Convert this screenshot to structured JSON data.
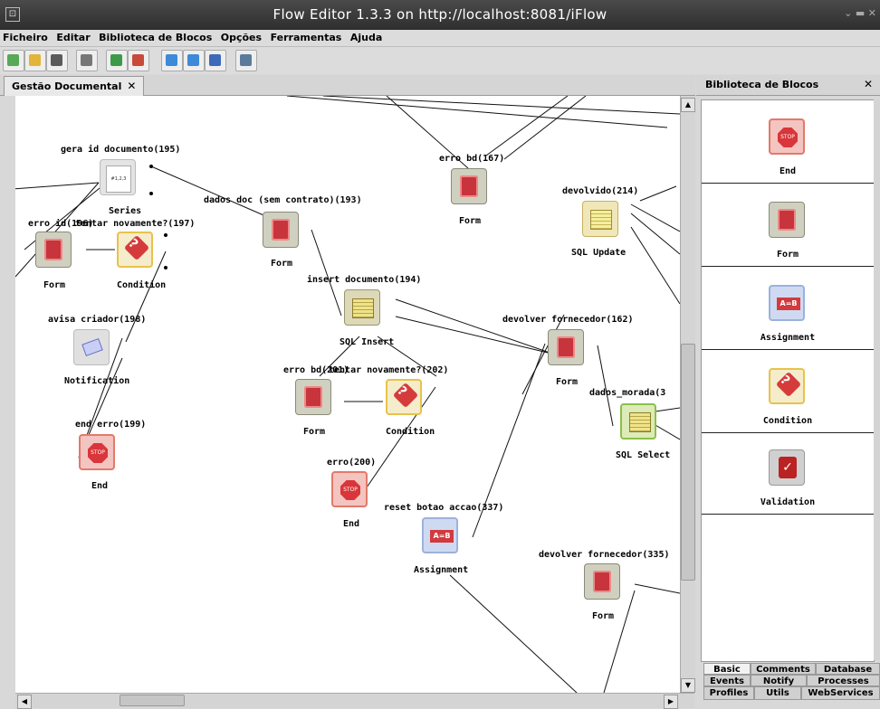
{
  "window": {
    "title": "Flow Editor 1.3.3 on http://localhost:8081/iFlow"
  },
  "menu": [
    "Ficheiro",
    "Editar",
    "Biblioteca de Blocos",
    "Opções",
    "Ferramentas",
    "Ajuda"
  ],
  "toolbar": [
    {
      "icon": "new-document-icon",
      "color": "#57a857"
    },
    {
      "icon": "open-folder-icon",
      "color": "#e2b43a"
    },
    {
      "icon": "save-icon",
      "color": "#5a5a5a"
    },
    {
      "icon": "print-icon",
      "color": "#777777"
    },
    {
      "icon": "export-icon",
      "color": "#3c9a4a"
    },
    {
      "icon": "import-icon",
      "color": "#c84a3a"
    },
    {
      "icon": "zoom-in-icon",
      "color": "#3c8ad8"
    },
    {
      "icon": "zoom-icon",
      "color": "#3c8ad8"
    },
    {
      "icon": "fit-icon",
      "color": "#3c6ab8"
    },
    {
      "icon": "view-icon",
      "color": "#5c7a9c"
    }
  ],
  "editor_tab": {
    "label": "Gestão Documental",
    "close": "✕"
  },
  "nodes": [
    {
      "id": "n1",
      "title": "gera id documento(195)",
      "type": "Series",
      "icon": "series"
    },
    {
      "id": "n2",
      "title": "erro id(196)",
      "type": "Form",
      "icon": "form"
    },
    {
      "id": "n3",
      "title": "tentar novamente?(197)",
      "type": "Condition",
      "icon": "cond"
    },
    {
      "id": "n4",
      "title": "avisa criador(198)",
      "type": "Notification",
      "icon": "notif"
    },
    {
      "id": "n5",
      "title": "end erro(199)",
      "type": "End",
      "icon": "end"
    },
    {
      "id": "n6",
      "title": "dados doc (sem contrato)(193)",
      "type": "Form",
      "icon": "form"
    },
    {
      "id": "n7",
      "title": "insert documento(194)",
      "type": "SQL Insert",
      "icon": "sql"
    },
    {
      "id": "n8",
      "title": "erro bd(201)",
      "type": "Form",
      "icon": "form"
    },
    {
      "id": "n9",
      "title": "tentar novamente?(202)",
      "type": "Condition",
      "icon": "cond"
    },
    {
      "id": "n10",
      "title": "erro(200)",
      "type": "End",
      "icon": "end"
    },
    {
      "id": "n11",
      "title": "reset botao accao(337)",
      "type": "Assignment",
      "icon": "assign"
    },
    {
      "id": "n12",
      "title": "erro bd(167)",
      "type": "Form",
      "icon": "form"
    },
    {
      "id": "n13",
      "title": "devolvido(214)",
      "type": "SQL Update",
      "icon": "sqlu"
    },
    {
      "id": "n14",
      "title": "devolver fornecedor(162)",
      "type": "Form",
      "icon": "form"
    },
    {
      "id": "n15",
      "title": "dados_morada(3",
      "type": "SQL Select",
      "icon": "sqls"
    },
    {
      "id": "n16",
      "title": "devolver fornecedor(335)",
      "type": "Form",
      "icon": "form"
    }
  ],
  "panel": {
    "title": "Biblioteca de Blocos",
    "close": "✕",
    "items": [
      {
        "label": "End",
        "icon": "end"
      },
      {
        "label": "Form",
        "icon": "form"
      },
      {
        "label": "Assignment",
        "icon": "assign"
      },
      {
        "label": "Condition",
        "icon": "cond"
      },
      {
        "label": "Validation",
        "icon": "valid"
      }
    ],
    "tabs": {
      "row1": [
        "Basic",
        "Comments",
        "Database"
      ],
      "row2": [
        "Events",
        "Notify",
        "Processes"
      ],
      "row3": [
        "Profiles",
        "Utils",
        "WebServices"
      ]
    }
  }
}
